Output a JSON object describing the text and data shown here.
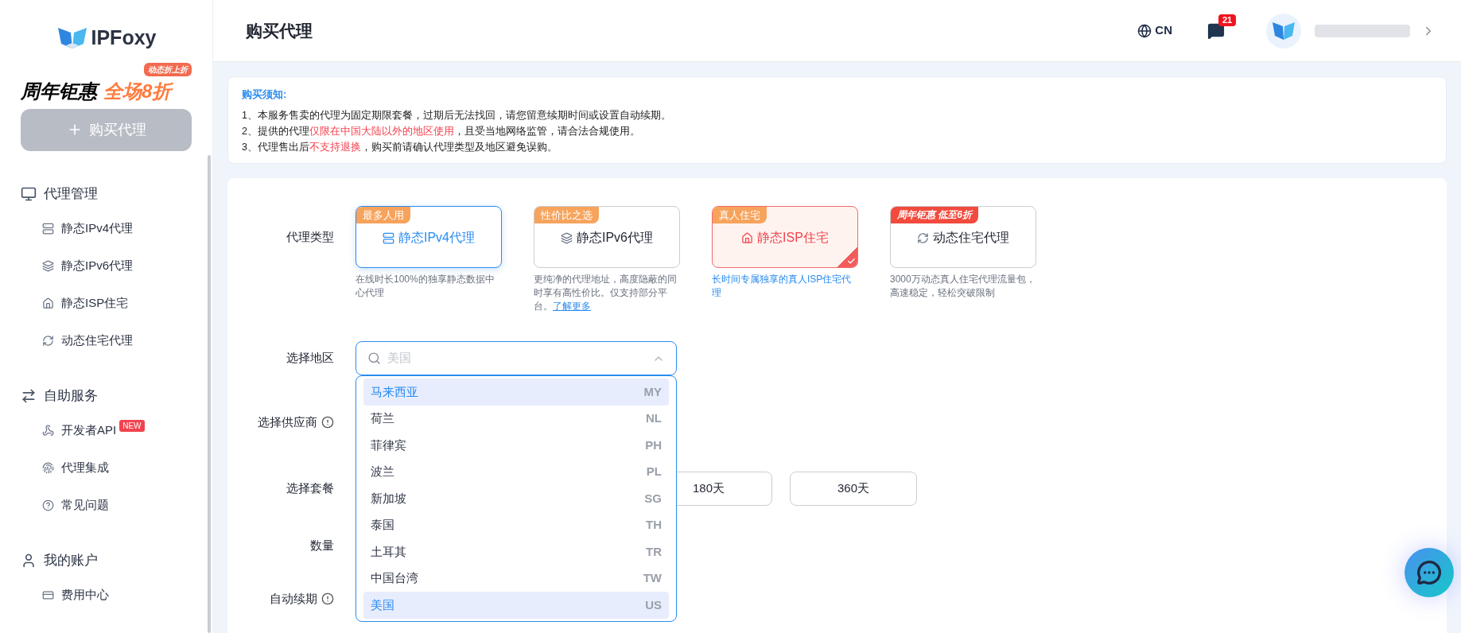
{
  "sidebar": {
    "logo": "IPFoxy",
    "promo": {
      "text_a": "周年钜惠",
      "text_b": "全场8折",
      "badge": "动态折上折"
    },
    "buy_button": {
      "label": "购买代理",
      "disabled": true
    },
    "sections": [
      {
        "title": "代理管理",
        "items": [
          {
            "label": "静态IPv4代理"
          },
          {
            "label": "静态IPv6代理"
          },
          {
            "label": "静态ISP住宅"
          },
          {
            "label": "动态住宅代理"
          }
        ]
      },
      {
        "title": "自助服务",
        "items": [
          {
            "label": "开发者API",
            "badge": "NEW"
          },
          {
            "label": "代理集成"
          },
          {
            "label": "常见问题"
          }
        ]
      },
      {
        "title": "我的账户",
        "items": [
          {
            "label": "费用中心"
          }
        ]
      }
    ]
  },
  "header": {
    "title": "购买代理",
    "language": "CN",
    "messages_count": "21"
  },
  "notice": {
    "title": "购买须知:",
    "lines": [
      [
        {
          "text": "1、本服务售卖的代理为固定期限套餐，过期后无法找回，请您留意续期时间或设置自动续期。",
          "highlight": false
        }
      ],
      [
        {
          "text": "2、提供的代理",
          "highlight": false
        },
        {
          "text": "仅限在中国大陆以外的地区使用",
          "highlight": true
        },
        {
          "text": "，且受当地网络监管，请合法合规使用。",
          "highlight": false
        }
      ],
      [
        {
          "text": "3、代理售出后",
          "highlight": false
        },
        {
          "text": "不支持退换",
          "highlight": true
        },
        {
          "text": "，购买前请确认代理类型及地区避免误购。",
          "highlight": false
        }
      ]
    ]
  },
  "form": {
    "proxy_type": {
      "label": "代理类型",
      "options": [
        {
          "badge": "最多人用",
          "kind": "plain",
          "label": "静态IPv4代理",
          "description": "在线时长100%的独享静态数据中心代理",
          "selected": false,
          "hovered": true
        },
        {
          "badge": "性价比之选",
          "kind": "plain",
          "label": "静态IPv6代理",
          "description": "更纯净的代理地址，高度隐蔽的同时享有高性价比。仅支持部分平台。",
          "link": "了解更多",
          "selected": false,
          "hovered": false
        },
        {
          "badge": "真人住宅",
          "kind": "plain",
          "label": "静态ISP住宅",
          "description": "长时间专属独享的真人ISP住宅代理",
          "selected": true,
          "hovered": false
        },
        {
          "badge": "周年钜惠 低至6折",
          "kind": "promo",
          "label": "动态住宅代理",
          "description": "3000万动态真人住宅代理流量包，高速稳定，轻松突破限制",
          "selected": false,
          "hovered": false
        }
      ]
    },
    "region": {
      "label": "选择地区",
      "placeholder": "美国",
      "expanded": true,
      "options": [
        {
          "name": "马来西亚",
          "code": "MY",
          "highlighted": true
        },
        {
          "name": "荷兰",
          "code": "NL",
          "highlighted": false
        },
        {
          "name": "菲律宾",
          "code": "PH",
          "highlighted": false
        },
        {
          "name": "波兰",
          "code": "PL",
          "highlighted": false
        },
        {
          "name": "新加坡",
          "code": "SG",
          "highlighted": false
        },
        {
          "name": "泰国",
          "code": "TH",
          "highlighted": false
        },
        {
          "name": "土耳其",
          "code": "TR",
          "highlighted": false
        },
        {
          "name": "中国台湾",
          "code": "TW",
          "highlighted": false
        },
        {
          "name": "美国",
          "code": "US",
          "highlighted": true
        }
      ]
    },
    "provider": {
      "label": "选择供应商"
    },
    "plan": {
      "label": "选择套餐",
      "options": [
        {
          "label": "180天",
          "selected": false
        },
        {
          "label": "360天",
          "selected": false
        }
      ]
    },
    "quantity": {
      "label": "数量"
    },
    "auto_renew": {
      "label": "自动续期"
    }
  }
}
